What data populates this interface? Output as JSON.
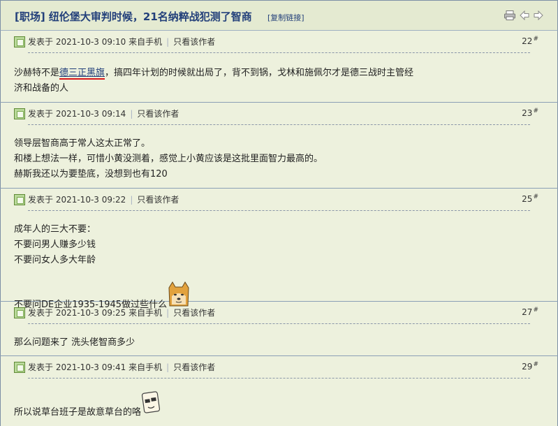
{
  "thread": {
    "title": "[职场] 纽伦堡大审判时候，21名纳粹战犯测了智商",
    "copy_link": "[复制链接]",
    "icons": [
      "print-icon",
      "prev-icon",
      "next-icon"
    ]
  },
  "posts": [
    {
      "meta_posted": "发表于 2021-10-3 09:10 来自手机",
      "only_author": "只看该作者",
      "floor": "22",
      "floor_mark": "#",
      "lines": [
        {
          "before": "沙赫特不是",
          "link": "德三正黑旗",
          "after": "，搞四年计划的时候就出局了，背不到锅，戈林和施佩尔才是德三战时主管经"
        },
        {
          "before": "济和战备的人"
        }
      ]
    },
    {
      "meta_posted": "发表于 2021-10-3 09:14",
      "only_author": "只看该作者",
      "floor": "23",
      "floor_mark": "#",
      "lines": [
        {
          "before": "领导层智商高于常人这太正常了。"
        },
        {
          "before": "和楼上想法一样，可惜小黄没测着，感觉上小黄应该是这批里面智力最高的。"
        },
        {
          "before": "赫斯我还以为要垫底，没想到也有120"
        }
      ]
    },
    {
      "meta_posted": "发表于 2021-10-3 09:22",
      "only_author": "只看该作者",
      "floor": "25",
      "floor_mark": "#",
      "lines": [
        {
          "before": "成年人的三大不要："
        },
        {
          "before": "不要问男人赚多少钱"
        },
        {
          "before": "不要问女人多大年龄"
        },
        {
          "before": ""
        },
        {
          "before": "不要问DE企业1935-1945做过些什么"
        }
      ],
      "emoji": "doge-face-emoji"
    },
    {
      "meta_posted": "发表于 2021-10-3 09:25 来自手机",
      "only_author": "只看该作者",
      "floor": "27",
      "floor_mark": "#",
      "lines": [
        {
          "before": "那么问题来了 洗头佬智商多少"
        }
      ]
    },
    {
      "meta_posted": "发表于 2021-10-3 09:41 来自手机",
      "only_author": "只看该作者",
      "floor": "29",
      "floor_mark": "#",
      "lines": [
        {
          "before": "所以说草台班子是故意草台的咯"
        }
      ],
      "emoji": "sunglasses-face-emoji"
    }
  ],
  "colors": {
    "background": "#edf1dd",
    "title_text": "#223f7a",
    "border": "#7c8fa5",
    "underline_red": "#d81818"
  }
}
